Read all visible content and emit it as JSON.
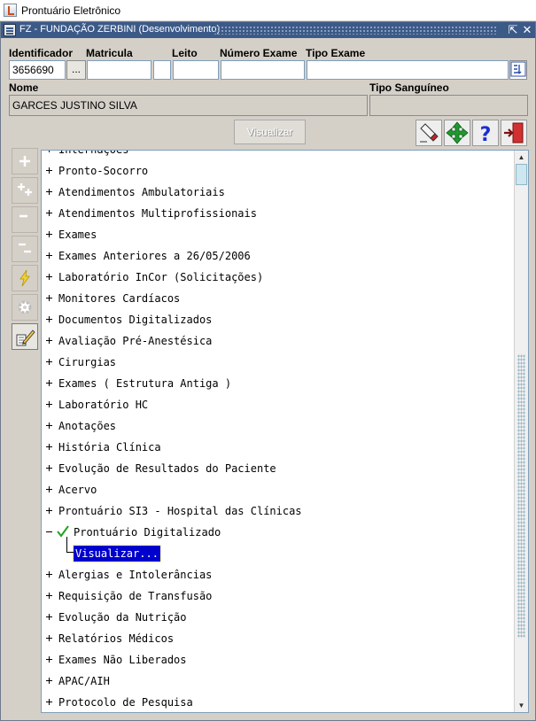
{
  "window": {
    "app_title": "Prontuário Eletrônico",
    "form_title": "FZ - FUNDAÇÃO ZERBINI (Desenvolvimento)"
  },
  "fields": {
    "identificador_label": "Identificador",
    "identificador_value": "3656690",
    "lookup_button": "...",
    "matricula_label": "Matricula",
    "matricula_value": "",
    "leito_label": "Leito",
    "leito_value": "",
    "numero_exame_label": "Número Exame",
    "numero_exame_value": "",
    "tipo_exame_label": "Tipo Exame",
    "tipo_exame_value": "",
    "nome_label": "Nome",
    "nome_value": "GARCES JUSTINO SILVA",
    "tipo_sanguineo_label": "Tipo Sanguíneo",
    "tipo_sanguineo_value": ""
  },
  "toolbar": {
    "visualizar_label": "Visualizar",
    "icons": [
      "eraser-icon",
      "move-arrows-icon",
      "help-icon",
      "exit-icon"
    ]
  },
  "left_tools": [
    "expand-icon",
    "expand-all-icon",
    "collapse-icon",
    "collapse-all-icon",
    "lightning-icon",
    "gear-icon",
    "edit-pencil-icon"
  ],
  "tree": {
    "items": [
      {
        "label": "Internações",
        "state": "collapsed"
      },
      {
        "label": "Pronto-Socorro",
        "state": "collapsed"
      },
      {
        "label": "Atendimentos Ambulatoriais",
        "state": "collapsed"
      },
      {
        "label": "Atendimentos Multiprofissionais",
        "state": "collapsed"
      },
      {
        "label": "Exames",
        "state": "collapsed"
      },
      {
        "label": "Exames Anteriores a 26/05/2006",
        "state": "collapsed"
      },
      {
        "label": "Laboratório InCor (Solicitações)",
        "state": "collapsed"
      },
      {
        "label": "Monitores Cardíacos",
        "state": "collapsed"
      },
      {
        "label": "Documentos Digitalizados",
        "state": "collapsed"
      },
      {
        "label": "Avaliação Pré-Anestésica",
        "state": "collapsed"
      },
      {
        "label": "Cirurgias",
        "state": "collapsed"
      },
      {
        "label": "Exames ( Estrutura Antiga )",
        "state": "collapsed"
      },
      {
        "label": "Laboratório HC",
        "state": "collapsed"
      },
      {
        "label": "Anotações",
        "state": "collapsed"
      },
      {
        "label": "História Clínica",
        "state": "collapsed"
      },
      {
        "label": "Evolução de Resultados do Paciente",
        "state": "collapsed"
      },
      {
        "label": "Acervo",
        "state": "collapsed"
      },
      {
        "label": "Prontuário SI3 - Hospital das Clínicas",
        "state": "collapsed"
      },
      {
        "label": "Prontuário Digitalizado",
        "state": "expanded"
      },
      {
        "label": "Visualizar...",
        "state": "child-selected"
      },
      {
        "label": "Alergias e Intolerâncias",
        "state": "collapsed"
      },
      {
        "label": "Requisição de Transfusão",
        "state": "collapsed"
      },
      {
        "label": "Evolução da Nutrição",
        "state": "collapsed"
      },
      {
        "label": "Relatórios Médicos",
        "state": "collapsed"
      },
      {
        "label": "Exames Não Liberados",
        "state": "collapsed"
      },
      {
        "label": "APAC/AIH",
        "state": "collapsed"
      },
      {
        "label": "Protocolo de Pesquisa",
        "state": "collapsed"
      }
    ]
  },
  "colors": {
    "form_title_bg": "#3c5a88",
    "window_bg": "#d4d0c8",
    "selection_bg": "#0000cc",
    "check_green": "#22a022"
  }
}
